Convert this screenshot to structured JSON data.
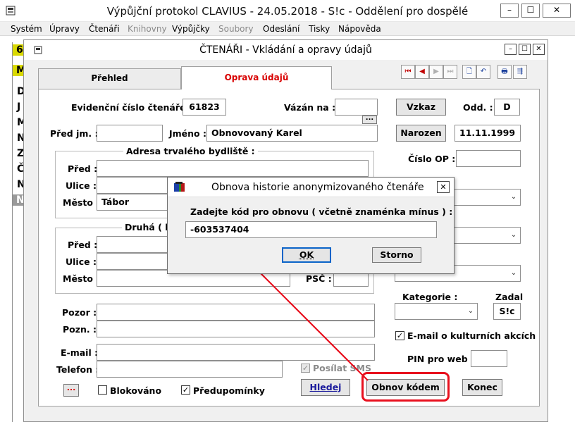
{
  "main_window": {
    "title": "Výpůjční protokol CLAVIUS - 24.05.2018 - S!c - Oddělení pro dospělé",
    "controls": [
      "–",
      "☐",
      "✕"
    ]
  },
  "menu": [
    {
      "label": "Systém",
      "u": "S",
      "disabled": false
    },
    {
      "label": "Úpravy",
      "u": "Ú",
      "disabled": false
    },
    {
      "label": "Čtenáři",
      "u": "Č",
      "disabled": false
    },
    {
      "label": "Knihovny",
      "u": "K",
      "disabled": true
    },
    {
      "label": "Výpůjčky",
      "u": "V",
      "disabled": false
    },
    {
      "label": "Soubory",
      "u": "b",
      "disabled": true
    },
    {
      "label": "Odeslání",
      "u": "O",
      "disabled": false
    },
    {
      "label": "Tisky",
      "u": "T",
      "disabled": false
    },
    {
      "label": "Nápověda",
      "u": "N",
      "disabled": false
    }
  ],
  "left_strip_letters": [
    "6",
    "M",
    "D",
    "J",
    "M",
    "N",
    "Z",
    "Č",
    "N",
    "N"
  ],
  "inner_window": {
    "title": "ČTENÁŘI - Vkládání a opravy údajů",
    "controls": [
      "–",
      "☐",
      "✕"
    ]
  },
  "tabs": [
    {
      "label": "Přehled",
      "active": false
    },
    {
      "label": "Oprava údajů",
      "active": true
    }
  ],
  "toolbar_icons": [
    {
      "name": "first-record-icon",
      "glyph": "⏮"
    },
    {
      "name": "prev-record-icon",
      "glyph": "◀"
    },
    {
      "name": "next-record-icon",
      "glyph": "▶"
    },
    {
      "name": "last-record-icon",
      "glyph": "⏭"
    },
    {
      "name": "new-document-icon",
      "glyph": "🗋"
    },
    {
      "name": "undo-icon",
      "glyph": "↶"
    },
    {
      "name": "printer-icon",
      "glyph": "🖶"
    },
    {
      "name": "export-icon",
      "glyph": "⇶"
    }
  ],
  "form": {
    "evid_label": "Evidenční číslo čtenáře :",
    "evid_value": "61823",
    "vazan_label": "Vázán na :",
    "vazan_value": "",
    "dots_label": "...",
    "vzkaz_button": "Vzkaz",
    "odd_label": "Odd. :",
    "odd_value": "D",
    "pred_jm_label": "Před jm. :",
    "pred_jm_value": "",
    "jmeno_label": "Jméno :",
    "jmeno_value": "Obnovovaný Karel",
    "narozen_button": "Narozen",
    "narozen_value": "11.11.1999",
    "cislo_op_label": "Číslo OP :",
    "cislo_op_value": "",
    "adresa_title": "Adresa trvalého bydliště :",
    "pred_label": "Před :",
    "ulice_label": "Ulice :",
    "mesto_label": "Město :",
    "mesto_value": "Tábor",
    "druha_title": "Druhá ( k",
    "psc_label": "PSČ :",
    "kategorie_label": "Kategorie :",
    "zadal_label": "Zadal",
    "zadal_value": "S!c",
    "pozor_label": "Pozor :",
    "pozn_label": "Pozn. :",
    "email_check_label": "E-mail o kulturních akcích",
    "email_label": "E-mail :",
    "pin_label": "PIN pro web :",
    "telefon_label": "Telefon :",
    "posilat_sms_label": "Posílat SMS",
    "blokovano_label": "Blokováno",
    "predupominky_label": "Předupomínky",
    "hledej_button": "Hledej",
    "obnov_button": "Obnov kódem",
    "konec_button": "Konec"
  },
  "dialog": {
    "title": "Obnova historie anonymizovaného čtenáře",
    "prompt": "Zadejte kód pro obnovu ( včetně znaménka mínus ) :",
    "code_value": "-603537404",
    "ok_label": "OK",
    "storno_label": "Storno"
  },
  "colors": {
    "active_tab_text": "#d80000",
    "annotation_red": "#e8101e"
  }
}
